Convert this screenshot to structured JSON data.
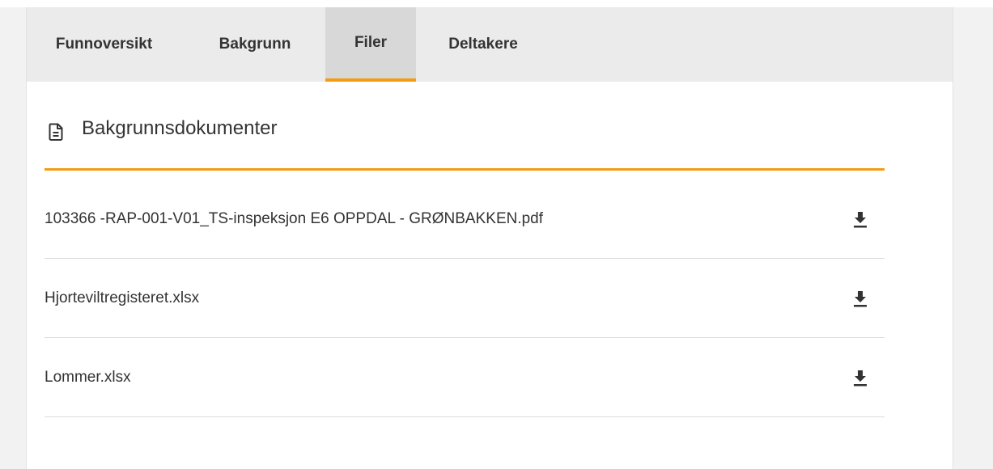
{
  "tabs": [
    {
      "label": "Funnoversikt",
      "active": false
    },
    {
      "label": "Bakgrunn",
      "active": false
    },
    {
      "label": "Filer",
      "active": true
    },
    {
      "label": "Deltakere",
      "active": false
    }
  ],
  "section": {
    "icon": "document-icon",
    "title": "Bakgrunnsdokumenter"
  },
  "files": [
    {
      "name": "103366 -RAP-001-V01_TS-inspeksjon E6 OPPDAL - GRØNBAKKEN.pdf",
      "action_icon": "download-icon"
    },
    {
      "name": "Hjorteviltregisteret.xlsx",
      "action_icon": "download-icon"
    },
    {
      "name": "Lommer.xlsx",
      "action_icon": "download-icon"
    }
  ],
  "colors": {
    "accent": "#f39c12",
    "tabbar_bg": "#ebebeb",
    "active_tab_bg": "#d8d8d8",
    "text": "#333333"
  }
}
